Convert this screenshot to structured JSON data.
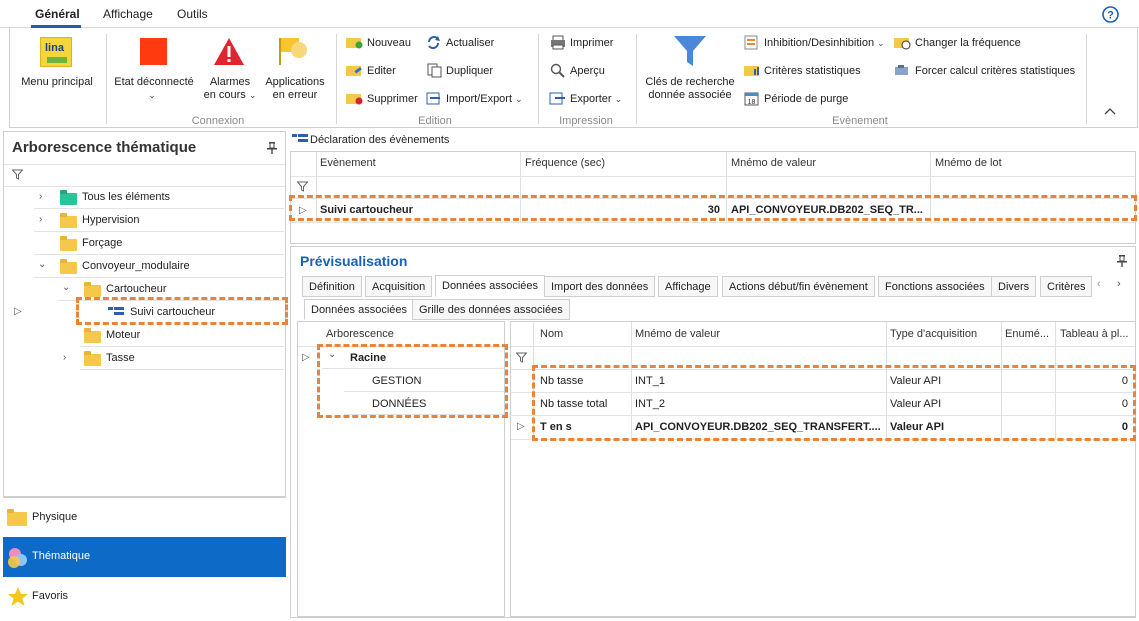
{
  "ribbon_tabs": [
    "Général",
    "Affichage",
    "Outils"
  ],
  "ribbon": {
    "menu_principal": "Menu principal",
    "lina_logo": "lina",
    "etat": "Etat déconnecté",
    "alarmes_1": "Alarmes",
    "alarmes_2": "en cours",
    "applications_1": "Applications",
    "applications_2": "en erreur",
    "group_connexion": "Connexion",
    "nouveau": "Nouveau",
    "actualiser": "Actualiser",
    "editer": "Editer",
    "dupliquer": "Dupliquer",
    "supprimer": "Supprimer",
    "import_export": "Import/Export",
    "group_edition": "Edition",
    "imprimer": "Imprimer",
    "apercu": "Aperçu",
    "exporter": "Exporter",
    "group_impression": "Impression",
    "cles_1": "Clés de recherche",
    "cles_2": "donnée associée",
    "inhibition": "Inhibition/Desinhibition",
    "criteres_stat": "Critères statistiques",
    "periode_purge": "Période de purge",
    "changer_freq": "Changer la fréquence",
    "forcer_calcul": "Forcer calcul critères statistiques",
    "group_evenement": "Evènement"
  },
  "left_panel": {
    "title": "Arborescence thématique",
    "tree": [
      "Tous les éléments",
      "Hypervision",
      "Forçage",
      "Convoyeur_modulaire",
      "Cartoucheur",
      "Suivi cartoucheur",
      "Moteur",
      "Tasse"
    ]
  },
  "nav": {
    "physique": "Physique",
    "thematique": "Thématique",
    "favoris": "Favoris"
  },
  "events": {
    "title": "Déclaration des évènements",
    "columns": [
      "Evènement",
      "Fréquence (sec)",
      "Mnémo de valeur",
      "Mnémo de lot"
    ],
    "row": {
      "evenement": "Suivi cartoucheur",
      "frequence": "30",
      "mnemo": "API_CONVOYEUR.DB202_SEQ_TR..."
    }
  },
  "preview": {
    "title": "Prévisualisation",
    "tabs": [
      "Définition",
      "Acquisition",
      "Données associées",
      "Import des données",
      "Affichage",
      "Actions début/fin évènement",
      "Fonctions associées",
      "Divers",
      "Critères"
    ],
    "subtabs": [
      "Données associées",
      "Grille des données associées"
    ],
    "tree_header": "Arborescence",
    "tree_root": "Racine",
    "tree_items": [
      "GESTION",
      "DONNÉES"
    ],
    "columns": [
      "Nom",
      "Mnémo de valeur",
      "Type d'acquisition",
      "Enumé...",
      "Tableau à pl..."
    ],
    "rows": [
      {
        "nom": "Nb tasse",
        "mnemo": "INT_1",
        "type": "Valeur API",
        "tableau": "0"
      },
      {
        "nom": "Nb tasse total",
        "mnemo": "INT_2",
        "type": "Valeur API",
        "tableau": "0"
      },
      {
        "nom": "T en s",
        "mnemo": "API_CONVOYEUR.DB202_SEQ_TRANSFERT....",
        "type": "Valeur API",
        "tableau": "0"
      }
    ]
  },
  "colors": {
    "accent": "#0d6bc7",
    "highlight": "#e7843a",
    "folder": "#f5c84a",
    "title_blue": "#1d5fb4"
  }
}
